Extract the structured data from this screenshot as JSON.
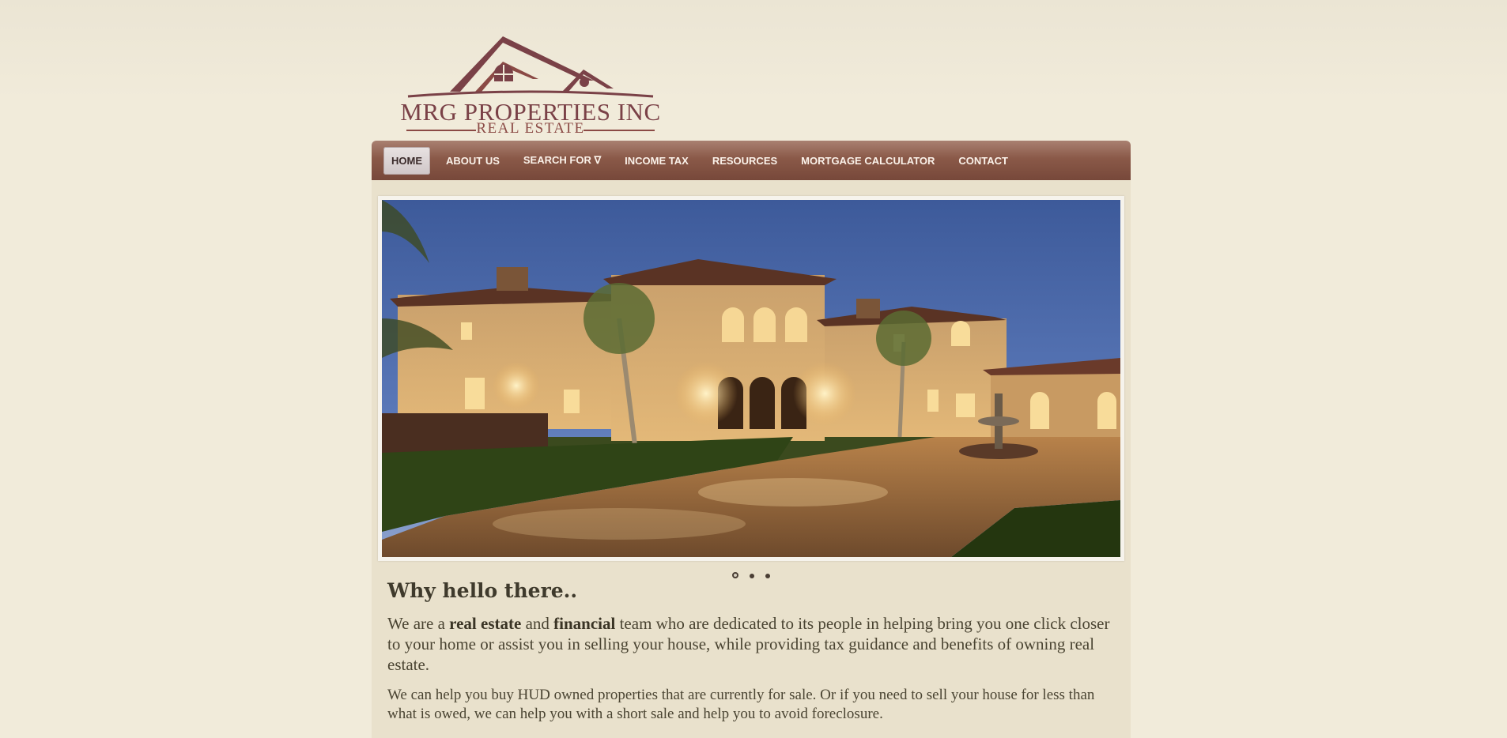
{
  "logo": {
    "title": "MRG PROPERTIES INC",
    "subtitle": "REAL ESTATE",
    "brand_color": "#7a4147"
  },
  "nav": {
    "items": [
      {
        "label": "HOME",
        "active": true
      },
      {
        "label": "ABOUT US",
        "active": false
      },
      {
        "label": "SEARCH FOR ∇",
        "active": false
      },
      {
        "label": "INCOME TAX",
        "active": false
      },
      {
        "label": "RESOURCES",
        "active": false
      },
      {
        "label": "MORTGAGE CALCULATOR",
        "active": false
      },
      {
        "label": "CONTACT",
        "active": false
      }
    ],
    "bar_color": "#8a5948"
  },
  "slider": {
    "image": "luxury-house-at-dusk",
    "slide_count": 3,
    "active_slide": 1
  },
  "content": {
    "heading": "Why hello there..",
    "para1": {
      "t1": "We are a ",
      "b1": "real estate",
      "t2": " and ",
      "b2": "financial",
      "t3": " team who are dedicated to its people in helping bring you one click closer to your home or assist you in selling your house, while providing tax guidance and benefits of owning real estate."
    },
    "para2": "We can help you buy HUD owned properties that are currently for sale. Or if you need to sell your house for less than what is owed, we can help you with a short sale and help you to avoid foreclosure."
  }
}
